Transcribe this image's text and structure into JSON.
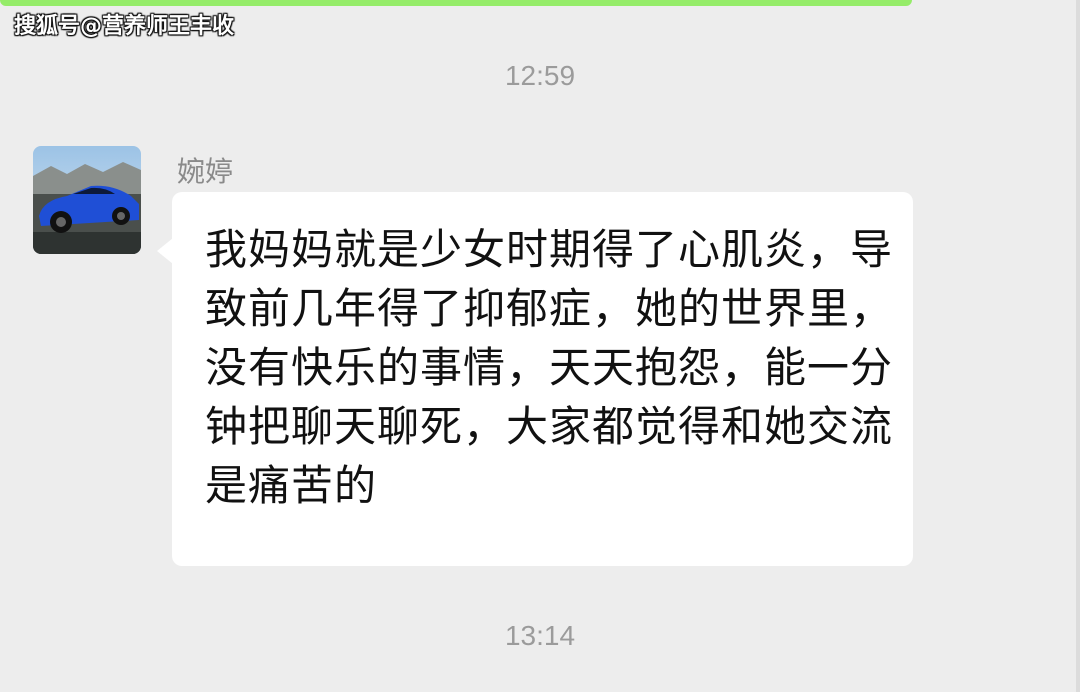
{
  "watermark": "搜狐号@营养师王丰收",
  "timestamps": [
    "12:59",
    "13:14"
  ],
  "message": {
    "sender": "婉婷",
    "avatar_icon": "blue-sports-car-avatar",
    "text": "我妈妈就是少女时期得了心肌炎，导致前几年得了抑郁症，她的世界里，没有快乐的事情，天天抱怨，能一分钟把聊天聊死，大家都觉得和她交流是痛苦的"
  },
  "colors": {
    "background": "#ededed",
    "bubble_incoming": "#ffffff",
    "bubble_outgoing": "#95ec69"
  }
}
